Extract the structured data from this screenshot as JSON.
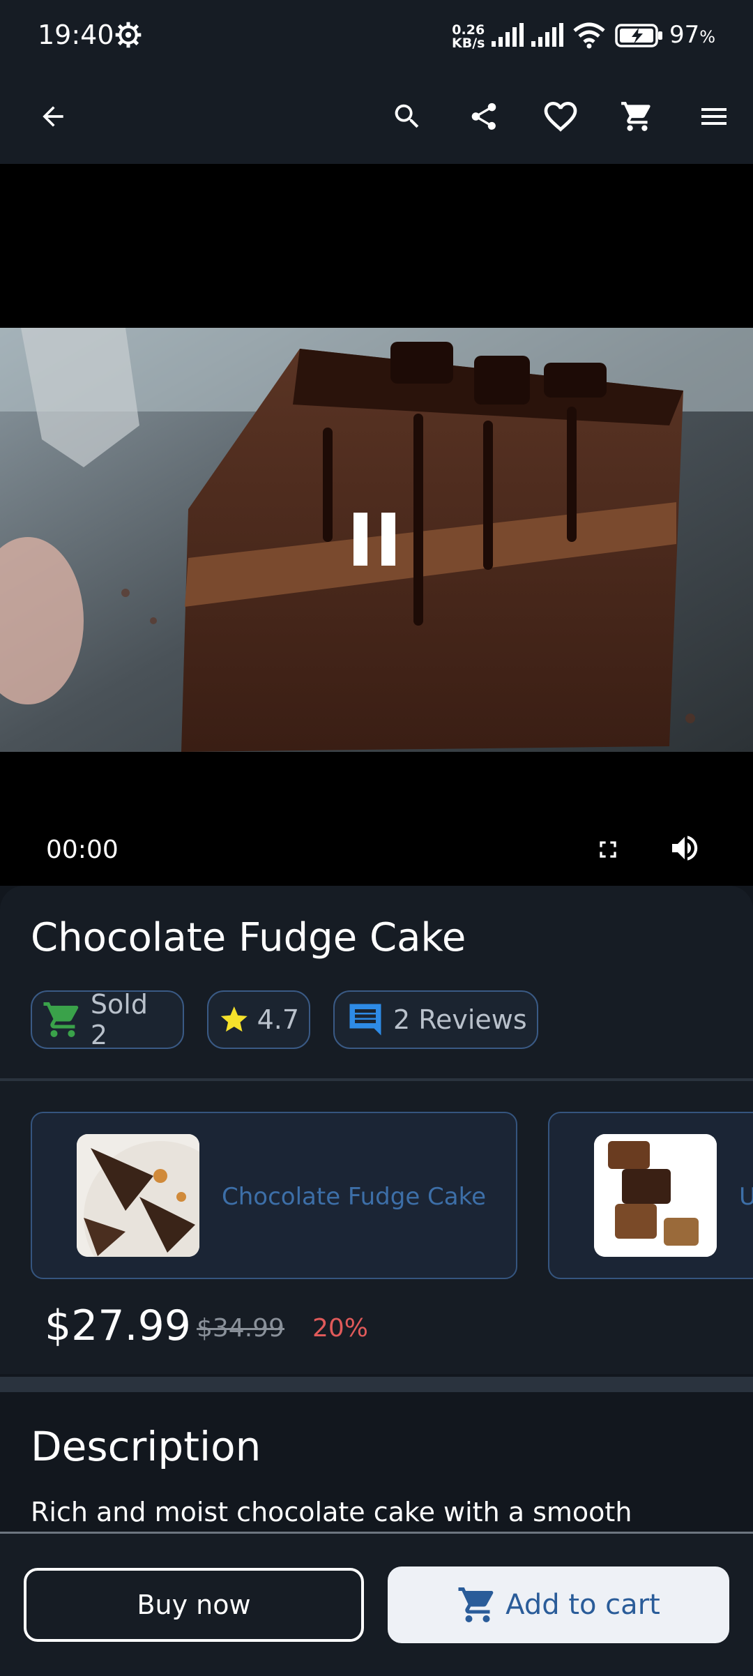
{
  "status_bar": {
    "time": "19:40",
    "net_speed_value": "0.26",
    "net_speed_unit": "KB/s",
    "battery_percent": "97",
    "battery_unit": "%"
  },
  "app_bar": {
    "icons": [
      "back-arrow-icon",
      "search-icon",
      "share-icon",
      "heart-icon",
      "cart-icon",
      "menu-icon"
    ]
  },
  "video": {
    "current_time": "00:00",
    "state": "playing"
  },
  "product": {
    "title": "Chocolate Fudge Cake",
    "sold": "Sold 2",
    "rating": "4.7",
    "reviews": "2 Reviews",
    "price": "$27.99",
    "old_price": "$34.99",
    "discount": "20%"
  },
  "variants": [
    {
      "label": "Chocolate Fudge Cake",
      "selected": true
    },
    {
      "label": "U",
      "selected": false
    }
  ],
  "description": {
    "title": "Description",
    "text": "Rich and moist chocolate cake with a smooth"
  },
  "actions": {
    "buy_now": "Buy now",
    "add_to_cart": "Add to cart"
  },
  "colors": {
    "background": "#12171e",
    "accent_blue": "#2a5c99",
    "discount_red": "#e05a5a",
    "chip_border": "#3a5a85"
  }
}
